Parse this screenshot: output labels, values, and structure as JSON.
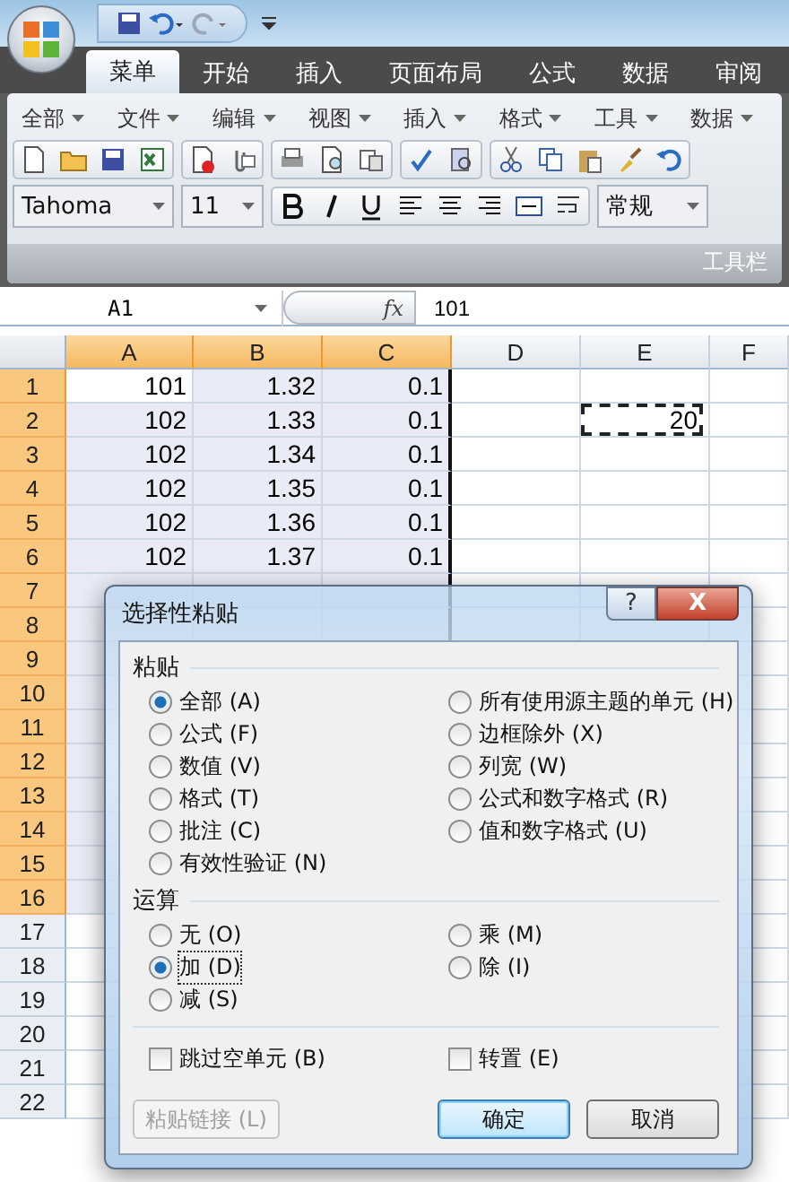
{
  "tabs": [
    {
      "label": "菜单",
      "selected": true
    },
    {
      "label": "开始",
      "selected": false
    },
    {
      "label": "插入",
      "selected": false
    },
    {
      "label": "页面布局",
      "selected": false
    },
    {
      "label": "公式",
      "selected": false
    },
    {
      "label": "数据",
      "selected": false
    },
    {
      "label": "审阅",
      "selected": false
    }
  ],
  "menu_bar": [
    "全部",
    "文件",
    "编辑",
    "视图",
    "插入",
    "格式",
    "工具",
    "数据"
  ],
  "font_name": "Tahoma",
  "font_size": "11",
  "number_format": "常规",
  "group_label": "工具栏",
  "formula_bar": {
    "name_box": "A1",
    "function_label": "fx",
    "value": "101"
  },
  "columns": [
    {
      "label": "A",
      "selected": true
    },
    {
      "label": "B",
      "selected": true
    },
    {
      "label": "C",
      "selected": true
    },
    {
      "label": "D",
      "selected": false
    },
    {
      "label": "E",
      "selected": false
    },
    {
      "label": "F",
      "selected": false
    }
  ],
  "rows": [
    {
      "label": "1",
      "selected": true,
      "cells": [
        {
          "text": "101",
          "active": true
        },
        {
          "text": "1.32"
        },
        {
          "text": "0.1"
        }
      ]
    },
    {
      "label": "2",
      "selected": true,
      "cells": [
        {
          "text": "102"
        },
        {
          "text": "1.33"
        },
        {
          "text": "0.1"
        },
        {},
        {
          "text": "20",
          "copied": true
        }
      ]
    },
    {
      "label": "3",
      "selected": true,
      "cells": [
        {
          "text": "102"
        },
        {
          "text": "1.34"
        },
        {
          "text": "0.1"
        }
      ]
    },
    {
      "label": "4",
      "selected": true,
      "cells": [
        {
          "text": "102"
        },
        {
          "text": "1.35"
        },
        {
          "text": "0.1"
        }
      ]
    },
    {
      "label": "5",
      "selected": true,
      "cells": [
        {
          "text": "102"
        },
        {
          "text": "1.36"
        },
        {
          "text": "0.1"
        }
      ]
    },
    {
      "label": "6",
      "selected": true,
      "cells": [
        {
          "text": "102"
        },
        {
          "text": "1.37"
        },
        {
          "text": "0.1"
        }
      ]
    },
    {
      "label": "7",
      "selected": true,
      "cells": []
    },
    {
      "label": "8",
      "selected": true,
      "cells": []
    },
    {
      "label": "9",
      "selected": true,
      "cells": []
    },
    {
      "label": "10",
      "selected": true,
      "cells": []
    },
    {
      "label": "11",
      "selected": true,
      "cells": []
    },
    {
      "label": "12",
      "selected": true,
      "cells": []
    },
    {
      "label": "13",
      "selected": true,
      "cells": []
    },
    {
      "label": "14",
      "selected": true,
      "cells": []
    },
    {
      "label": "15",
      "selected": true,
      "cells": []
    },
    {
      "label": "16",
      "selected": true,
      "cells": []
    },
    {
      "label": "17",
      "selected": false,
      "cells": []
    },
    {
      "label": "18",
      "selected": false,
      "cells": []
    },
    {
      "label": "19",
      "selected": false,
      "cells": []
    },
    {
      "label": "20",
      "selected": false,
      "cells": []
    },
    {
      "label": "21",
      "selected": false,
      "cells": []
    },
    {
      "label": "22",
      "selected": false,
      "cells": []
    }
  ],
  "dialog": {
    "title": "选择性粘贴",
    "help": "?",
    "close": "X",
    "paste_section": {
      "label": "粘贴",
      "options": [
        {
          "label": "全部 (A)",
          "selected": true
        },
        {
          "label": "公式 (F)",
          "selected": false
        },
        {
          "label": "数值 (V)",
          "selected": false
        },
        {
          "label": "格式 (T)",
          "selected": false
        },
        {
          "label": "批注 (C)",
          "selected": false
        },
        {
          "label": "有效性验证 (N)",
          "selected": false
        },
        {
          "label": "所有使用源主题的单元 (H)",
          "selected": false
        },
        {
          "label": "边框除外 (X)",
          "selected": false
        },
        {
          "label": "列宽 (W)",
          "selected": false
        },
        {
          "label": "公式和数字格式 (R)",
          "selected": false
        },
        {
          "label": "值和数字格式 (U)",
          "selected": false
        }
      ]
    },
    "operation_section": {
      "label": "运算",
      "options": [
        {
          "label": "无 (O)",
          "selected": false,
          "focused": false
        },
        {
          "label": "加 (D)",
          "selected": true,
          "focused": true
        },
        {
          "label": "减 (S)",
          "selected": false,
          "focused": false
        },
        {
          "label": "乘 (M)",
          "selected": false,
          "focused": false
        },
        {
          "label": "除 (I)",
          "selected": false,
          "focused": false
        }
      ]
    },
    "checkboxes": [
      {
        "label": "跳过空单元 (B)",
        "checked": false
      },
      {
        "label": "转置 (E)",
        "checked": false
      }
    ],
    "buttons": [
      {
        "label": "粘贴链接 (L)",
        "disabled": true,
        "default": false
      },
      {
        "label": "确定",
        "disabled": false,
        "default": true
      },
      {
        "label": "取消",
        "disabled": false,
        "default": false
      }
    ]
  }
}
